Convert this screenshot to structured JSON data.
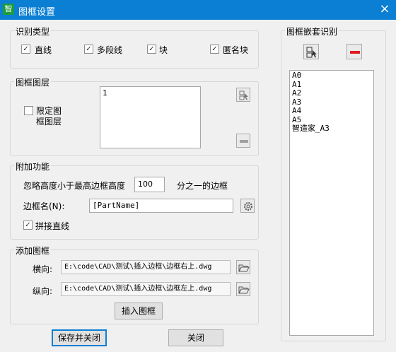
{
  "window": {
    "title": "图框设置",
    "app_icon": "智",
    "close_glyph": "×"
  },
  "recognize_type": {
    "group_label": "识别类型",
    "options": [
      {
        "label": "直线",
        "checked": true
      },
      {
        "label": "多段线",
        "checked": true
      },
      {
        "label": "块",
        "checked": true
      },
      {
        "label": "匿名块",
        "checked": true
      }
    ]
  },
  "frame_layer": {
    "group_label": "图框图层",
    "limit_label_line1": "限定图",
    "limit_label_line2": "框图层",
    "limit_checked": false,
    "layer_list": [
      "1"
    ]
  },
  "extra": {
    "group_label": "附加功能",
    "ignore_prefix": "忽略高度小于最高边框高度",
    "ignore_value": "100",
    "ignore_suffix": "分之一的边框",
    "frame_name_label": "边框名(N):",
    "frame_name_value": "[PartName]",
    "join_lines_label": "拼接直线",
    "join_lines_checked": true
  },
  "add_frame": {
    "group_label": "添加图框",
    "horizontal_label": "横向:",
    "horizontal_path": "E:\\code\\CAD\\测试\\插入边框\\边框右上.dwg",
    "vertical_label": "纵向:",
    "vertical_path": "E:\\code\\CAD\\测试\\插入边框\\边框左上.dwg",
    "insert_button": "插入图框"
  },
  "nested": {
    "group_label": "图框嵌套识别",
    "items": [
      "A0",
      "A1",
      "A2",
      "A3",
      "A4",
      "A5",
      "智造家_A3"
    ]
  },
  "footer": {
    "save_close": "保存并关闭",
    "close": "关闭"
  },
  "colors": {
    "titlebar": "#0b7fd4",
    "remove_red": "#e01b24",
    "accent_border": "#0b7fd4"
  }
}
